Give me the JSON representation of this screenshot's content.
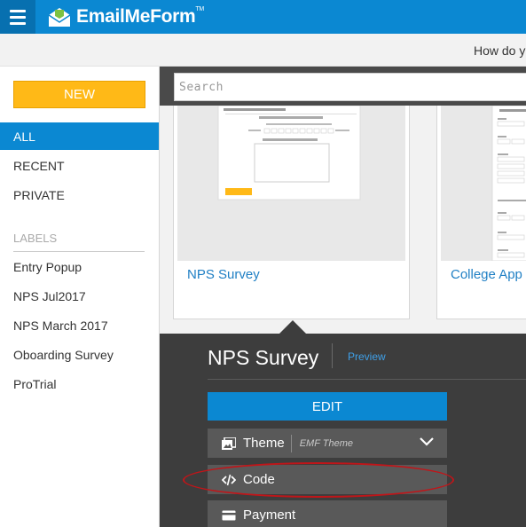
{
  "header": {
    "logo_text": "EmailMeForm",
    "logo_mark": "TM",
    "help_text": "How do y"
  },
  "sidebar": {
    "new_button": "NEW",
    "nav": [
      {
        "label": "ALL",
        "active": true
      },
      {
        "label": "RECENT",
        "active": false
      },
      {
        "label": "PRIVATE",
        "active": false
      }
    ],
    "labels_heading": "LABELS",
    "labels": [
      "Entry Popup",
      "NPS Jul2017",
      "NPS March 2017",
      "Oboarding Survey",
      "ProTrial"
    ]
  },
  "search": {
    "placeholder": "Search",
    "value": ""
  },
  "cards": [
    {
      "title": "NPS Survey"
    },
    {
      "title": "College App"
    }
  ],
  "details": {
    "title": "NPS Survey",
    "preview_label": "Preview",
    "edit_label": "EDIT",
    "options": [
      {
        "label": "Theme",
        "sublabel": "EMF Theme",
        "icon": "theme-icon"
      },
      {
        "label": "Code",
        "icon": "code-icon"
      },
      {
        "label": "Payment",
        "icon": "credit-card-icon"
      }
    ]
  },
  "colors": {
    "brand_blue": "#0b88d2",
    "new_yellow": "#ffb917",
    "dark_panel": "#3d3d3d",
    "highlight_red": "#c01519"
  }
}
